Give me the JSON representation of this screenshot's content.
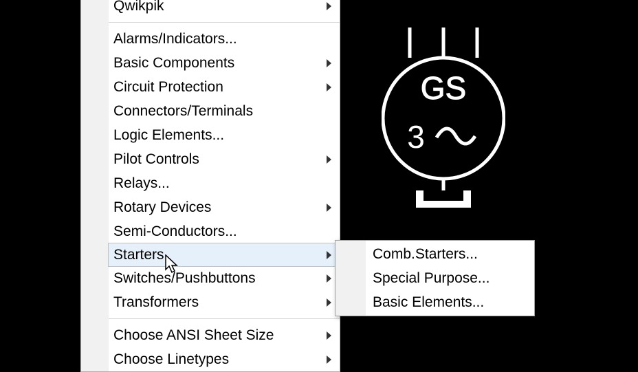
{
  "menu": {
    "items": [
      {
        "label": "Qwikpik",
        "hasSubmenu": true
      },
      {
        "separator": true
      },
      {
        "label": "Alarms/Indicators...",
        "hasSubmenu": false
      },
      {
        "label": "Basic Components",
        "hasSubmenu": true
      },
      {
        "label": "Circuit Protection",
        "hasSubmenu": true
      },
      {
        "label": "Connectors/Terminals",
        "hasSubmenu": false
      },
      {
        "label": "Logic Elements...",
        "hasSubmenu": false
      },
      {
        "label": "Pilot Controls",
        "hasSubmenu": true
      },
      {
        "label": "Relays...",
        "hasSubmenu": false
      },
      {
        "label": "Rotary Devices",
        "hasSubmenu": true
      },
      {
        "label": "Semi-Conductors...",
        "hasSubmenu": false
      },
      {
        "label": "Starters",
        "hasSubmenu": true,
        "highlighted": true
      },
      {
        "label": "Switches/Pushbuttons",
        "hasSubmenu": true
      },
      {
        "label": "Transformers",
        "hasSubmenu": true
      },
      {
        "separator": true
      },
      {
        "label": "Choose ANSI Sheet Size",
        "hasSubmenu": true
      },
      {
        "label": "Choose Linetypes",
        "hasSubmenu": true
      }
    ]
  },
  "submenu": {
    "items": [
      {
        "label": "Comb.Starters..."
      },
      {
        "label": "Special Purpose..."
      },
      {
        "label": "Basic Elements..."
      }
    ]
  },
  "symbolPreview": {
    "letters": "GS",
    "number": "3"
  }
}
